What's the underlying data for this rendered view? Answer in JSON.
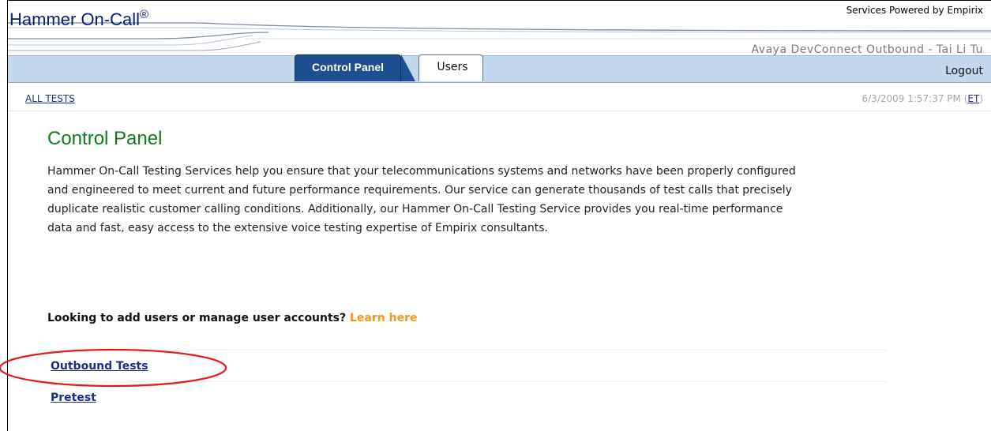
{
  "app": {
    "logo_text": "Hammer On-Call",
    "logo_mark": "®",
    "powered_by": "Services Powered by Empirix",
    "account": "Avaya DevConnect Outbound - Tai Li Tu",
    "logout": "Logout",
    "nav_color": "#c3d8ec",
    "active_tab_color": "#1e4f91"
  },
  "tabs": [
    {
      "label": "Control Panel",
      "active": true
    },
    {
      "label": "Users",
      "active": false
    }
  ],
  "breadcrumb": {
    "all_tests": "ALL TESTS",
    "datetime": "6/3/2009 1:57:37 PM",
    "tz_open": "(",
    "timezone": "ET",
    "tz_close": ")"
  },
  "main": {
    "title": "Control Panel",
    "intro": "Hammer On-Call Testing Services help you ensure that your telecommunications systems and networks have been properly configured and engineered to meet current and future performance requirements. Our service can generate thousands of test calls that precisely duplicate realistic customer calling conditions. Additionally, our Hammer On-Call Testing Service provides you real-time performance data and fast, easy access to the extensive voice testing expertise of Empirix consultants.",
    "manage_prompt": "Looking to add users or manage user accounts?",
    "learn_here": "Learn here",
    "tests": [
      {
        "label": "Outbound Tests",
        "highlighted": true
      },
      {
        "label": "Pretest",
        "highlighted": false
      }
    ],
    "highlight_color": "#e41b1b"
  }
}
